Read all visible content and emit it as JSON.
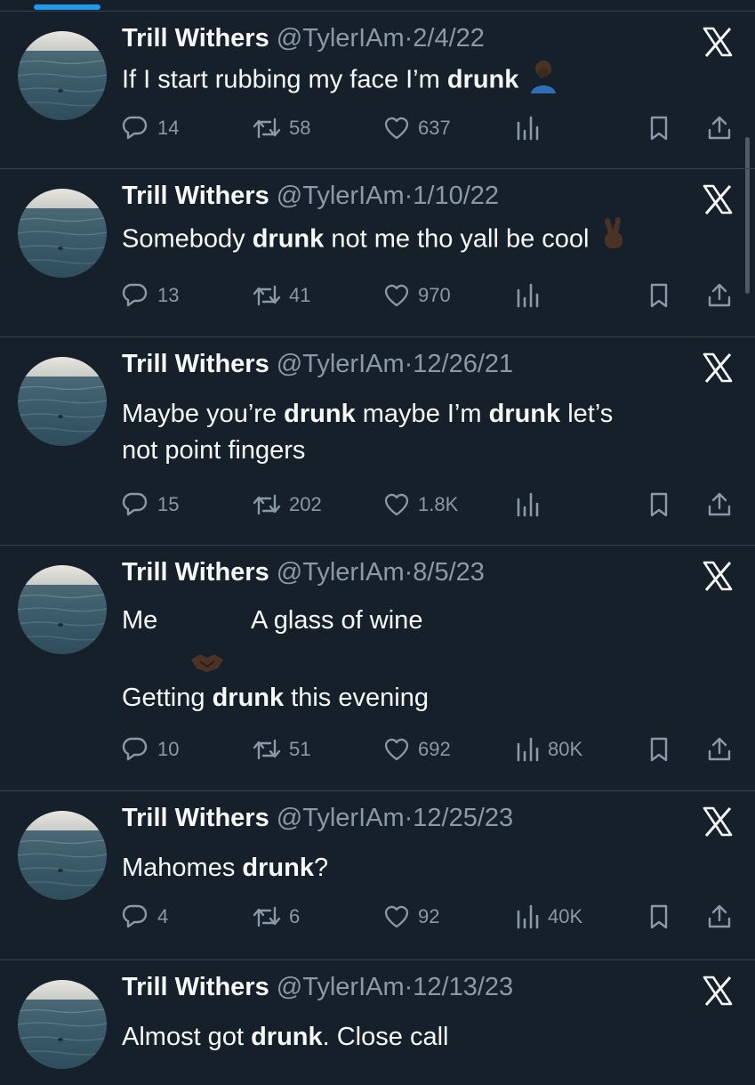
{
  "colors": {
    "background": "#15202b",
    "text": "#f7f9f9",
    "muted": "#8b98a5",
    "divider": "#38444d",
    "accent": "#1d9bf0"
  },
  "tweets": [
    {
      "name": "Trill Withers",
      "handle": "@TylerIAm",
      "dot": "·",
      "date": "2/4/22",
      "line1": [
        {
          "t": "If I start rubbing my face I’m "
        },
        {
          "t": "drunk",
          "b": true
        }
      ],
      "emoji": "facepalm-emoji",
      "replies": "14",
      "retweets": "58",
      "likes": "637",
      "views": ""
    },
    {
      "name": "Trill Withers",
      "handle": "@TylerIAm",
      "dot": "·",
      "date": "1/10/22",
      "line1": [
        {
          "t": "Somebody "
        },
        {
          "t": "drunk",
          "b": true
        },
        {
          "t": " not me tho yall be cool"
        }
      ],
      "emoji": "victory-hand-emoji",
      "replies": "13",
      "retweets": "41",
      "likes": "970",
      "views": ""
    },
    {
      "name": "Trill Withers",
      "handle": "@TylerIAm",
      "dot": "·",
      "date": "12/26/21",
      "line1": [
        {
          "t": "Maybe you’re "
        },
        {
          "t": "drunk",
          "b": true
        },
        {
          "t": " maybe I’m "
        },
        {
          "t": "drunk",
          "b": true
        },
        {
          "t": " let’s"
        }
      ],
      "line2": [
        {
          "t": "not point fingers"
        }
      ],
      "replies": "15",
      "retweets": "202",
      "likes": "1.8K",
      "views": ""
    },
    {
      "name": "Trill Withers",
      "handle": "@TylerIAm",
      "dot": "·",
      "date": "8/5/23",
      "line1a": "Me",
      "line1b": "A glass of wine",
      "emoji": "handshake-emoji",
      "line3": [
        {
          "t": "Getting "
        },
        {
          "t": "drunk",
          "b": true
        },
        {
          "t": " this evening"
        }
      ],
      "replies": "10",
      "retweets": "51",
      "likes": "692",
      "views": "80K"
    },
    {
      "name": "Trill Withers",
      "handle": "@TylerIAm",
      "dot": "·",
      "date": "12/25/23",
      "line1": [
        {
          "t": "Mahomes "
        },
        {
          "t": "drunk",
          "b": true
        },
        {
          "t": "?"
        }
      ],
      "replies": "4",
      "retweets": "6",
      "likes": "92",
      "views": "40K"
    },
    {
      "name": "Trill Withers",
      "handle": "@TylerIAm",
      "dot": "·",
      "date": "12/13/23",
      "line1": [
        {
          "t": "Almost got "
        },
        {
          "t": "drunk",
          "b": true
        },
        {
          "t": ". Close call"
        }
      ]
    }
  ]
}
